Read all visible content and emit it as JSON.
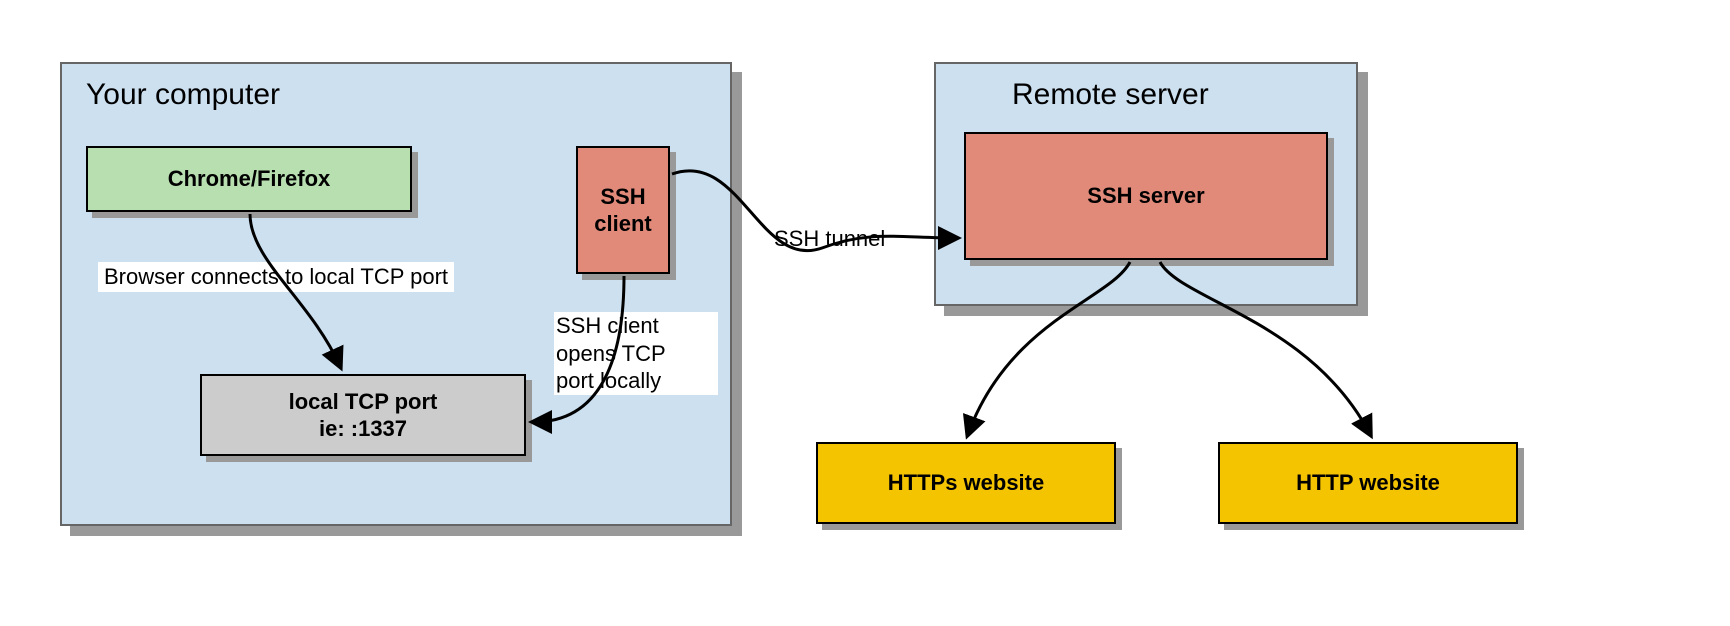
{
  "diagram": {
    "your_computer": {
      "title": "Your computer",
      "browser_box": "Chrome/Firefox",
      "tcp_port_line1": "local TCP port",
      "tcp_port_line2": "ie: :1337",
      "ssh_client_line1": "SSH",
      "ssh_client_line2": "client",
      "arrow_browser_to_port": "Browser connects to local TCP port",
      "arrow_sshclient_to_port_l1": "SSH client",
      "arrow_sshclient_to_port_l2": "opens TCP",
      "arrow_sshclient_to_port_l3": "port locally"
    },
    "tunnel_label": "SSH tunnel",
    "remote_server": {
      "title": "Remote server",
      "ssh_server_box": "SSH server"
    },
    "https_box": "HTTPs website",
    "http_box": "HTTP website"
  },
  "colors": {
    "container_blue": "#cce0f0",
    "green": "#b7dfb0",
    "red": "#e18a7a",
    "grey": "#cccccc",
    "yellow": "#f5c400",
    "shadow": "#999999"
  }
}
